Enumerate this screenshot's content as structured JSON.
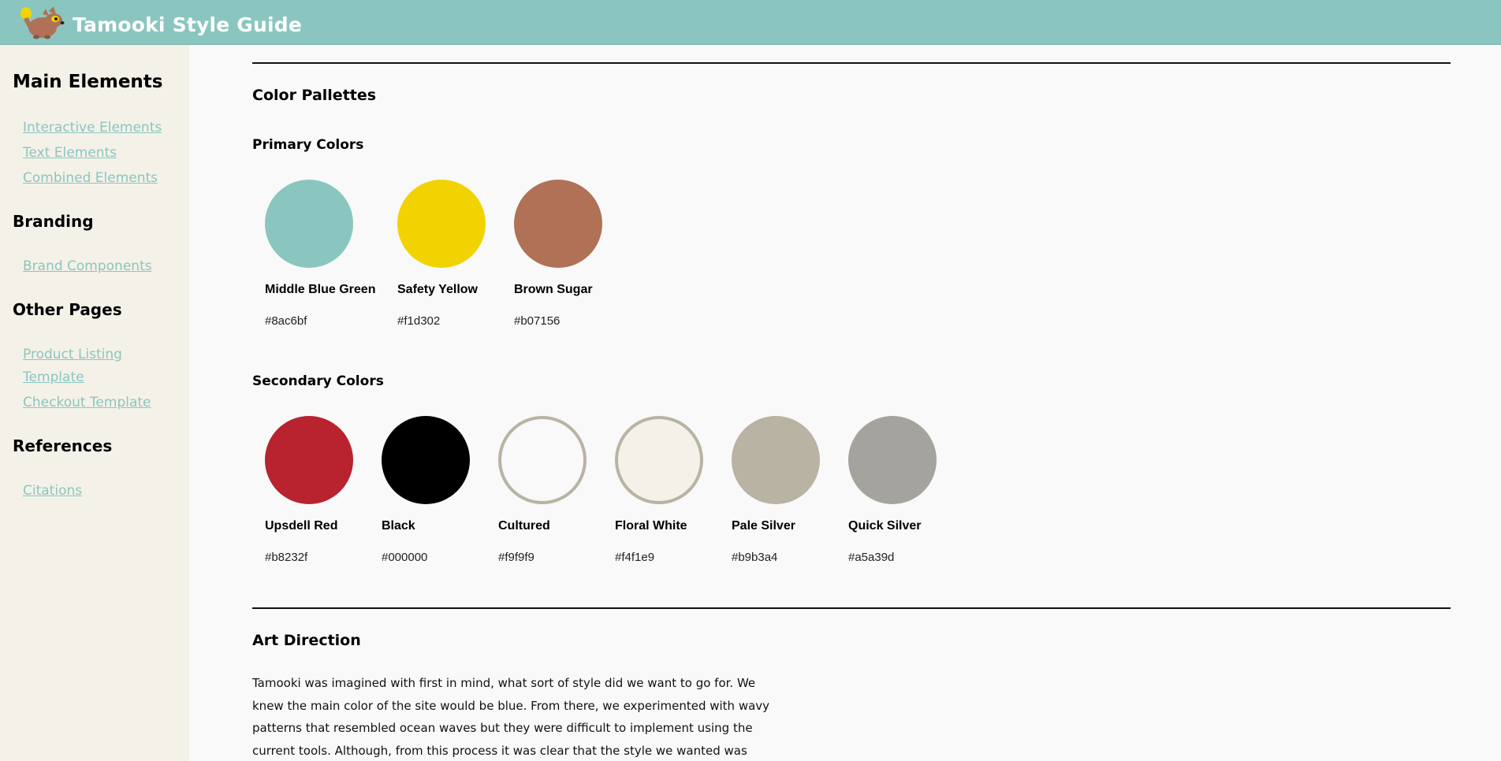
{
  "header": {
    "title": "Tamooki Style Guide",
    "logo_icon": "raccoon-logo-icon"
  },
  "sidebar": {
    "sections": [
      {
        "heading": "Main Elements",
        "links": [
          "Interactive Elements",
          "Text Elements",
          "Combined Elements"
        ]
      },
      {
        "heading": "Branding",
        "links": [
          "Brand Components"
        ]
      },
      {
        "heading": "Other Pages",
        "links": [
          "Product Listing Template",
          "Checkout Template"
        ]
      },
      {
        "heading": "References",
        "links": [
          "Citations"
        ]
      }
    ]
  },
  "main": {
    "color_section_title": "Color Pallettes",
    "primary_title": "Primary Colors",
    "primary": [
      {
        "name": "Middle Blue Green",
        "hex": "#8ac6bf",
        "color": "#8ac6bf"
      },
      {
        "name": "Safety Yellow",
        "hex": "#f1d302",
        "color": "#f1d302"
      },
      {
        "name": "Brown Sugar",
        "hex": "#b07156",
        "color": "#b07156"
      }
    ],
    "secondary_title": "Secondary Colors",
    "secondary": [
      {
        "name": "Upsdell Red",
        "hex": "#b8232f",
        "color": "#b8232f"
      },
      {
        "name": "Black",
        "hex": "#000000",
        "color": "#000000"
      },
      {
        "name": "Cultured",
        "hex": "#f9f9f9",
        "color": "#f9f9f9"
      },
      {
        "name": "Floral White",
        "hex": "#f4f1e9",
        "color": "#f4f1e9"
      },
      {
        "name": "Pale Silver",
        "hex": "#b9b3a4",
        "color": "#b9b3a4"
      },
      {
        "name": "Quick Silver",
        "hex": "#a5a39d",
        "color": "#a5a39d"
      }
    ],
    "art_direction_title": "Art Direction",
    "art_direction_text": "Tamooki was imagined with first in mind, what sort of style did we want to go for. We knew the main color of the site would be blue. From there, we experimented with wavy patterns that resembled ocean waves but they were difficult to implement using the current tools. Although, from this process it was clear that the style we wanted was elements to have a"
  }
}
